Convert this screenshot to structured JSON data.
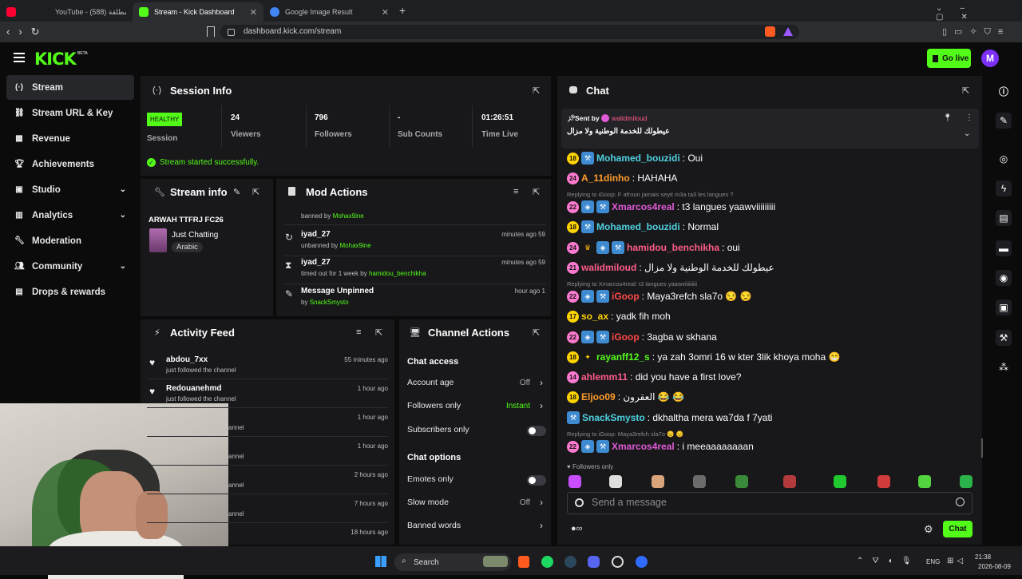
{
  "browser": {
    "tabs": [
      {
        "label": "YouTube - محلقة مطلقة (588)",
        "color": "#ff0033"
      },
      {
        "label": "Stream - Kick Dashboard",
        "color": "#53fc18"
      },
      {
        "label": "Google Image Result",
        "color": "#4285f4"
      }
    ],
    "url": "dashboard.kick.com/stream",
    "new_tab": "+"
  },
  "header": {
    "logo": "KICK",
    "logo_sup": "BETA",
    "go_live": "Go live",
    "avatar_letter": "M"
  },
  "sidebar": {
    "items": [
      {
        "label": "Stream",
        "icon": "broadcast-icon"
      },
      {
        "label": "Stream URL & Key",
        "icon": "link-icon"
      },
      {
        "label": "Revenue",
        "icon": "revenue-icon"
      },
      {
        "label": "Achievements",
        "icon": "trophy-icon"
      },
      {
        "label": "Studio",
        "icon": "studio-icon"
      },
      {
        "label": "Analytics",
        "icon": "analytics-icon"
      },
      {
        "label": "Moderation",
        "icon": "wrench-icon"
      },
      {
        "label": "Community",
        "icon": "people-icon"
      },
      {
        "label": "Drops & rewards",
        "icon": "gift-icon"
      }
    ]
  },
  "session": {
    "title": "Session Info",
    "status": "HEALTHY",
    "status_label": "Session",
    "stats": [
      {
        "value": "24",
        "label": "Viewers"
      },
      {
        "value": "796",
        "label": "Followers"
      },
      {
        "value": "-",
        "label": "Sub Counts"
      },
      {
        "value": "01:26:51",
        "label": "Time Live"
      }
    ],
    "message": "Stream started successfully."
  },
  "stream_info": {
    "title": "Stream info",
    "stream_title": "ARWAH TTFRJ FC26",
    "category": "Just Chatting",
    "language": "Arabic"
  },
  "mod_actions": {
    "title": "Mod Actions",
    "items": [
      {
        "action": "",
        "detail": "banned by",
        "actor": "Mohax9ine",
        "time": ""
      },
      {
        "action": "iyad_27",
        "detail": "unbanned by",
        "actor": "Mohax9ine",
        "time": "59 minutes ago"
      },
      {
        "action": "iyad_27",
        "detail": "timed out for 1 week by",
        "actor": "hamidou_benchikha",
        "time": "59 minutes ago"
      },
      {
        "action": "Message Unpinned",
        "detail": "by",
        "actor": "SnackSmysto",
        "time": "1 hour ago"
      }
    ]
  },
  "activity": {
    "title": "Activity Feed",
    "items": [
      {
        "user": "abdou_7xx",
        "detail": "just followed the channel",
        "time": "55 minutes ago"
      },
      {
        "user": "Redouanehmd",
        "detail": "just followed the channel",
        "time": "1 hour ago"
      },
      {
        "user": "",
        "detail": "annel",
        "time": "1 hour ago"
      },
      {
        "user": "",
        "detail": "annel",
        "time": "1 hour ago"
      },
      {
        "user": "",
        "detail": "annel",
        "time": "2 hours ago"
      },
      {
        "user": "",
        "detail": "annel",
        "time": "7 hours ago"
      },
      {
        "user": "",
        "detail": "",
        "time": "18 hours ago"
      }
    ]
  },
  "channel_actions": {
    "title": "Channel Actions",
    "chat_access": "Chat access",
    "chat_options": "Chat options",
    "rows": [
      {
        "label": "Account age",
        "value": "Off"
      },
      {
        "label": "Followers only",
        "value": "Instant"
      },
      {
        "label": "Subscribers only",
        "value": ""
      },
      {
        "label": "Emotes only",
        "value": ""
      },
      {
        "label": "Slow mode",
        "value": "Off"
      },
      {
        "label": "Banned words",
        "value": ""
      }
    ]
  },
  "chat": {
    "title": "Chat",
    "pinned": {
      "sent_by": "Sent by",
      "user": "walidmiloud",
      "text": "عيطولك للخدمة الوطنية ولا مزال"
    },
    "messages": [
      {
        "lvl": "18",
        "user": "Mohamed_bouzidi",
        "color": "#4fd1e0",
        "text": ": Oui",
        "reply": ""
      },
      {
        "lvl": "24",
        "user": "A_11dinho",
        "color": "#ff9c2a",
        "text": ": HAHAHA",
        "reply": ""
      },
      {
        "lvl": "22",
        "user": "Xmarcos4real",
        "color": "#e15bd6",
        "text": ": t3 langues yaawviiiiiiiii",
        "reply": "Replying to iGoop: F afroun jamais seyit m3a ta3 les langues ?"
      },
      {
        "lvl": "18",
        "user": "Mohamed_bouzidi",
        "color": "#4fd1e0",
        "text": ": Normal",
        "reply": ""
      },
      {
        "lvl": "24",
        "user": "hamidou_benchikha",
        "color": "#ff5c8a",
        "text": ": oui",
        "reply": ""
      },
      {
        "lvl": "21",
        "user": "walidmiloud",
        "color": "#ff5c8a",
        "text": ": عيطولك للخدمة الوطنية ولا مزال",
        "reply": ""
      },
      {
        "lvl": "22",
        "user": "iGoop",
        "color": "#ff4a4a",
        "text": ": Maya3refch sla7o 😒 😒",
        "reply": "Replying to Xmarcos4real: t3 langues yaawviiiiiiiii"
      },
      {
        "lvl": "17",
        "user": "so_ax",
        "color": "#ffd400",
        "text": ": yadk fih moh",
        "reply": ""
      },
      {
        "lvl": "22",
        "user": "iGoop",
        "color": "#ff4a4a",
        "text": ": 3agba w skhana",
        "reply": ""
      },
      {
        "lvl": "18",
        "user": "rayanff12_s",
        "color": "#53fc18",
        "text": ": ya zah 3omri 16 w kter 3lik khoya moha 😁",
        "reply": ""
      },
      {
        "lvl": "14",
        "user": "ahlemm11",
        "color": "#ff5c8a",
        "text": ": did you have a first love?",
        "reply": ""
      },
      {
        "lvl": "18",
        "user": "Eljoo09",
        "color": "#ff9c2a",
        "text": ": العقرون 😂 😂",
        "reply": ""
      },
      {
        "lvl": "",
        "user": "SnackSmysto",
        "color": "#4fd1e0",
        "text": ": dkhaltha mera wa7da f 7yati",
        "reply": ""
      },
      {
        "lvl": "22",
        "user": "Xmarcos4real",
        "color": "#e15bd6",
        "text": ": i meeaaaaaaaan",
        "reply": "Replying to iGoop: Maya3refch sla7o 😒 😒"
      }
    ],
    "followers_only": "Followers only",
    "placeholder": "Send a message",
    "send": "Chat"
  },
  "taskbar": {
    "search": "Search",
    "lang": "ENG",
    "time": "21:38",
    "date": "2026-08-09"
  }
}
